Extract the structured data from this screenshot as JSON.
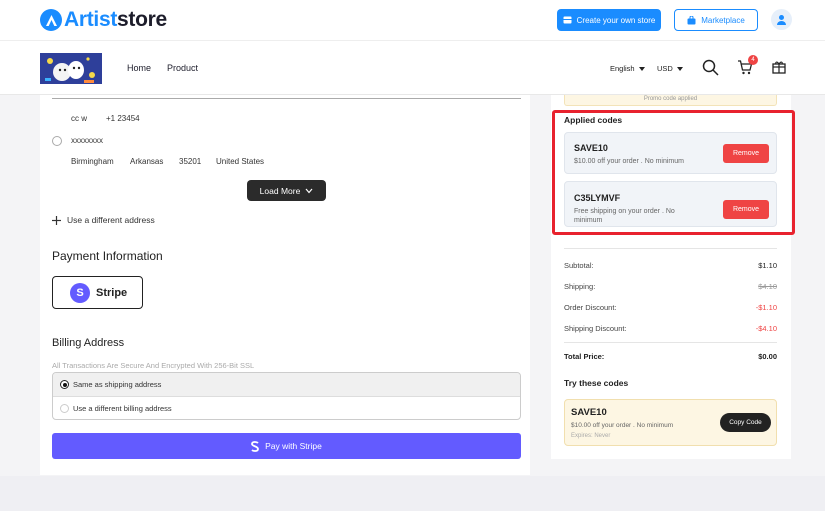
{
  "header": {
    "logo_a": "A",
    "logo_text_blue": "Artist",
    "logo_text_dark": "store",
    "create_store_label": "Create your own store",
    "marketplace_label": "Marketplace"
  },
  "nav": {
    "home": "Home",
    "product": "Product",
    "language": "English",
    "currency": "USD",
    "cart_count": "4"
  },
  "address": {
    "name": "cc w",
    "phone": "+1 23454",
    "line": "xxxxxxxx",
    "city": "Birmingham",
    "state": "Arkansas",
    "zip": "35201",
    "country": "United States"
  },
  "load_more_label": "Load More",
  "use_different_address": "Use a different address",
  "payment": {
    "title": "Payment Information",
    "stripe_letter": "S",
    "stripe_label": "Stripe"
  },
  "billing": {
    "title": "Billing Address",
    "secure_note": "All Transactions Are Secure And Encrypted With 256-Bit SSL",
    "option_same": "Same as shipping address",
    "option_different": "Use a different billing address"
  },
  "pay_button_label": "Pay with Stripe",
  "promo_strip": "Promo code applied",
  "applied": {
    "title": "Applied codes",
    "codes": [
      {
        "code": "SAVE10",
        "desc": "$10.00 off your order . No minimum",
        "action": "Remove"
      },
      {
        "code": "C35LYMVF",
        "desc": "Free shipping on your order . No minimum",
        "action": "Remove"
      }
    ]
  },
  "summary": {
    "subtotal_label": "Subtotal:",
    "subtotal": "$1.10",
    "shipping_label": "Shipping:",
    "shipping": "$4.10",
    "order_discount_label": "Order Discount:",
    "order_discount": "-$1.10",
    "shipping_discount_label": "Shipping Discount:",
    "shipping_discount": "-$4.10",
    "total_label": "Total Price:",
    "total": "$0.00"
  },
  "try_codes": {
    "title": "Try these codes",
    "code": "SAVE10",
    "desc": "$10.00 off your order . No minimum",
    "expires": "Expires: Never",
    "action": "Copy Code"
  },
  "colors": {
    "brand_blue": "#1a8cff",
    "stripe_purple": "#635bff",
    "danger_red": "#ef4444",
    "highlight_frame": "#e8222e"
  }
}
